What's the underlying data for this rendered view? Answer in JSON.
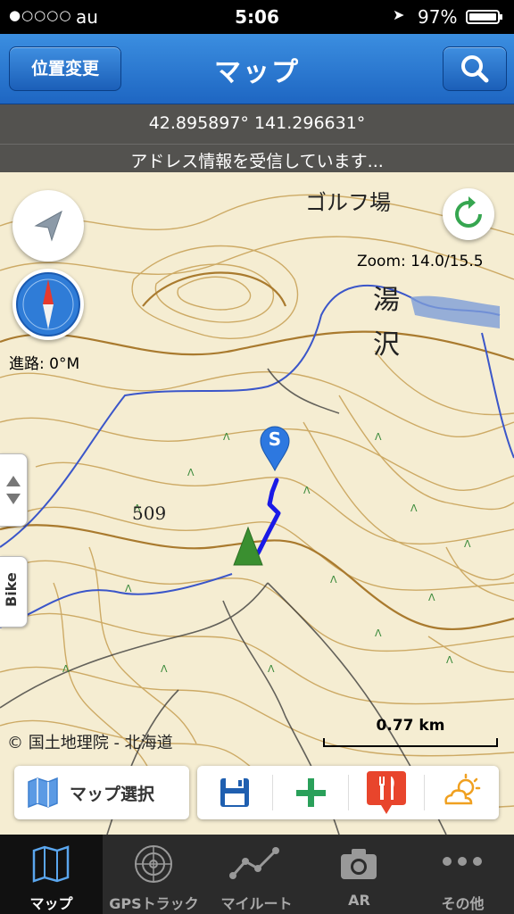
{
  "status": {
    "carrier": "au",
    "time": "5:06",
    "battery": "97%",
    "signal_dots": "●○○○○"
  },
  "nav": {
    "title": "マップ",
    "left_button": "位置変更",
    "right_icon": "search-icon"
  },
  "info": {
    "coords": "42.895897° 141.296631°",
    "address": "アドレス情報を受信しています..."
  },
  "map": {
    "zoom": "Zoom: 14.0/15.5",
    "heading": "進路: 0°M",
    "elevation": "509",
    "bike": "Bike",
    "credit": "© 国土地理院 - 北海道",
    "scale": "0.77 km",
    "place_labels": {
      "golf": "ゴルフ場",
      "yu": "湯",
      "sawa": "沢"
    },
    "start_marker": "S",
    "route_color": "#1a1ae6"
  },
  "toolbar": {
    "map_select": "マップ選択",
    "icons": [
      "save-icon",
      "add-icon",
      "restaurant-icon",
      "weather-icon"
    ]
  },
  "tabs": [
    {
      "label": "マップ",
      "icon": "map-icon",
      "active": true
    },
    {
      "label": "GPSトラック",
      "icon": "radar-icon",
      "active": false
    },
    {
      "label": "マイルート",
      "icon": "route-icon",
      "active": false
    },
    {
      "label": "AR",
      "icon": "camera-icon",
      "active": false
    },
    {
      "label": "その他",
      "icon": "more-icon",
      "active": false
    }
  ]
}
